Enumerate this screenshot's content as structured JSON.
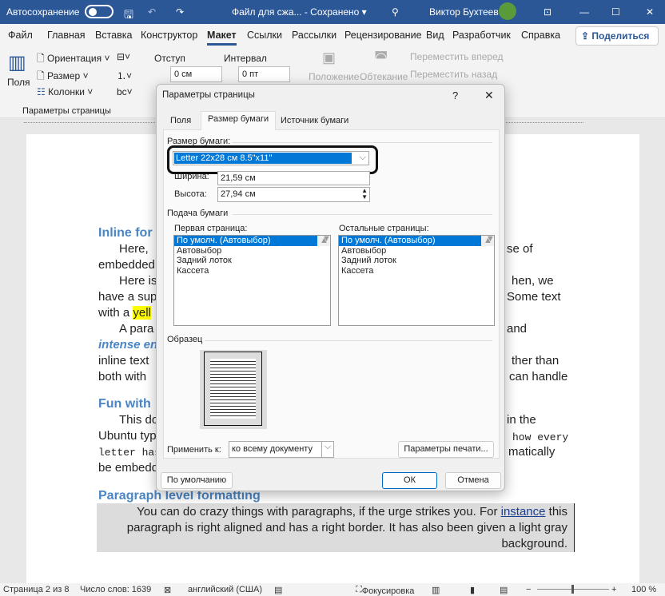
{
  "titlebar": {
    "autosave": "Автосохранение",
    "doc_title": "Файл для сжа...  -  Сохранено ▾",
    "user": "Виктор Бухтеев",
    "accent": "#2b5797"
  },
  "menu": {
    "items": [
      "Файл",
      "Главная",
      "Вставка",
      "Конструктор",
      "Макет",
      "Ссылки",
      "Рассылки",
      "Рецензирование",
      "Вид",
      "Разработчик",
      "Справка"
    ],
    "active": "Макет",
    "share": "Поделиться"
  },
  "ribbon": {
    "fields": "Поля",
    "orientation": "Ориентация",
    "size": "Размер",
    "columns": "Колонки",
    "indent_label": "Отступ",
    "spacing_label": "Интервал",
    "indent_value": "0 см",
    "spacing_value": "0 пт",
    "position": "Положение",
    "wrap": "Обтекание",
    "forward": "Переместить вперед",
    "backward": "Переместить назад",
    "group_label": "Параметры страницы"
  },
  "document": {
    "left": [
      "Inline for",
      "Here, ",
      "embedded",
      "Here is",
      "have a sup",
      "with a ",
      "A para",
      "intense en",
      "inline text",
      "both with ",
      "Fun with",
      "This do",
      "Ubuntu typ",
      "letter has",
      "be embedd",
      "Paragraph level formatting"
    ],
    "highlight": "yell",
    "right": [
      "se of",
      "hen, we",
      "Some text",
      "and",
      "ther than",
      "can handle",
      "in the",
      "how every",
      "matically"
    ],
    "gray_paragraph": [
      "You can do crazy things with paragraphs, if the urge strikes you. For ",
      "instance",
      " this",
      "paragraph is right aligned and has a right border. It has also been given a light gray",
      "background."
    ]
  },
  "dialog": {
    "title": "Параметры страницы",
    "help": "?",
    "close": "✕",
    "tabs": [
      "Поля",
      "Размер бумаги",
      "Источник бумаги"
    ],
    "active_tab": "Размер бумаги",
    "paper_size_label": "Размер бумаги:",
    "paper_size_value": "Letter 22x28 см 8.5\"x11\"",
    "width_label": "Ширина:",
    "width_value": "21,59 см",
    "height_label": "Высота:",
    "height_value": "27,94 см",
    "feed_label": "Подача бумаги",
    "first_page_label": "Первая страница:",
    "other_pages_label": "Остальные страницы:",
    "trays": [
      "По умолч. (Автовыбор)",
      "Автовыбор",
      "Задний лоток",
      "Кассета"
    ],
    "preview_label": "Образец",
    "apply_label": "Применить к:",
    "apply_value": "ко всему документу",
    "print_options": "Параметры печати...",
    "default": "По умолчанию",
    "ok": "ОК",
    "cancel": "Отмена"
  },
  "status": {
    "page": "Страница 2 из 8",
    "words": "Число слов: 1639",
    "language": "английский (США)",
    "focus": "Фокусировка",
    "zoom": "100 %"
  }
}
